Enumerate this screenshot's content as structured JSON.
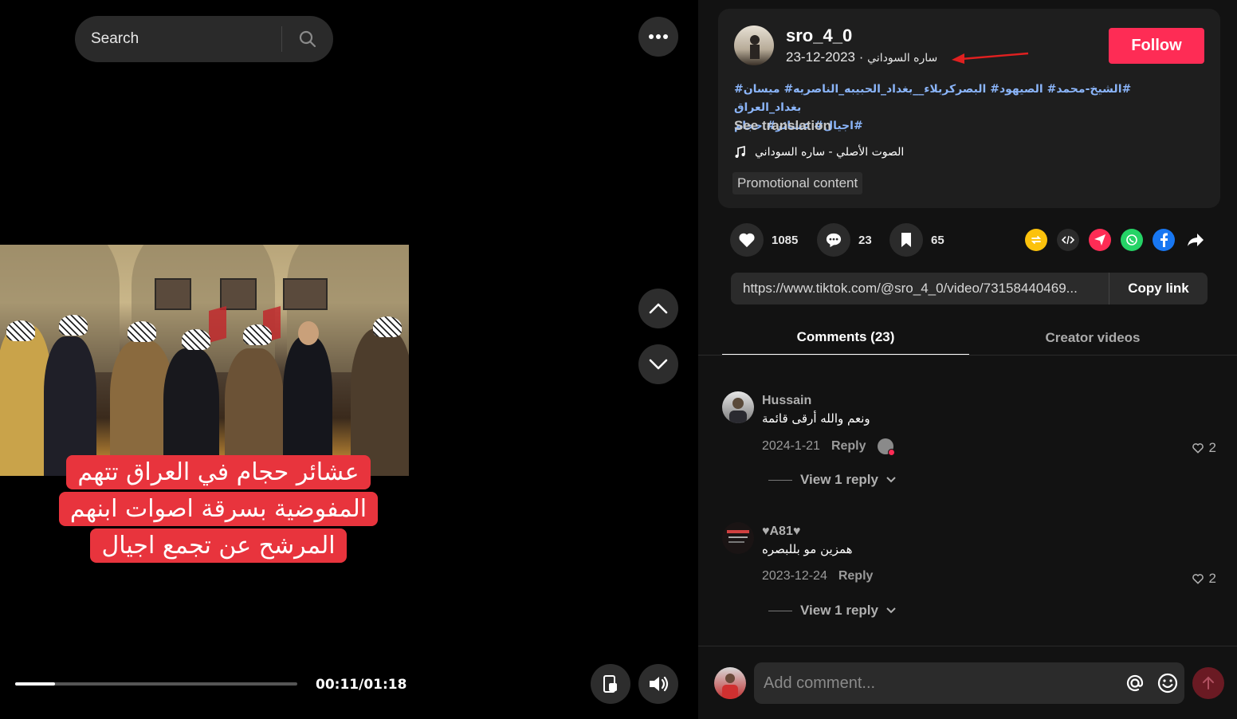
{
  "search": {
    "placeholder": "Search"
  },
  "video": {
    "caption": "عشائر حجام في العراق تتهم المفوضية بسرقة اصوات ابنهم المرشح عن تجمع اجيال",
    "time": "00:11/01:18",
    "progress_fraction": 0.14
  },
  "post": {
    "username": "sro_4_0",
    "display_name": "ساره السوداني",
    "date": "2023-12-23",
    "separator": "·",
    "follow_label": "Follow",
    "description_line1": "#الشيخ-محمد# الصيهود# البصركربلاء__بغداد_الحبيبه_الناصريه# ميسان# بغداد_العراق",
    "description_line2": "#اجيال# عشائر# حجام",
    "see_translation": "See translation",
    "music": "الصوت الأصلي - ساره السوداني",
    "promo": "Promotional content"
  },
  "stats": {
    "likes": "1085",
    "comments": "23",
    "saves": "65"
  },
  "share": {
    "icons": [
      "repost-icon",
      "embed-icon",
      "send-icon",
      "whatsapp-icon",
      "facebook-icon",
      "share-arrow-icon"
    ],
    "colors": {
      "repost": "#fcc20c",
      "embed": "#2b2b2b",
      "send": "#fe2c55",
      "whatsapp": "#25d366",
      "facebook": "#1877f2"
    }
  },
  "link": {
    "url": "https://www.tiktok.com/@sro_4_0/video/73158440469...",
    "copy_label": "Copy link"
  },
  "tabs": {
    "comments": "Comments (23)",
    "creator": "Creator videos"
  },
  "comments": [
    {
      "name": "Hussain",
      "text": "ونعم والله أرقى قائمة",
      "date": "2024-1-21",
      "reply": "Reply",
      "likes": "2",
      "view_replies": "View 1 reply"
    },
    {
      "name": "♥A81♥",
      "text": "همزين مو بللبصره",
      "date": "2023-12-24",
      "reply": "Reply",
      "likes": "2",
      "view_replies": "View 1 reply"
    }
  ],
  "composer": {
    "placeholder": "Add comment..."
  },
  "colors": {
    "accent": "#fe2c55",
    "link_blue": "#8ab4f8",
    "annotation_arrow": "#e02020"
  }
}
